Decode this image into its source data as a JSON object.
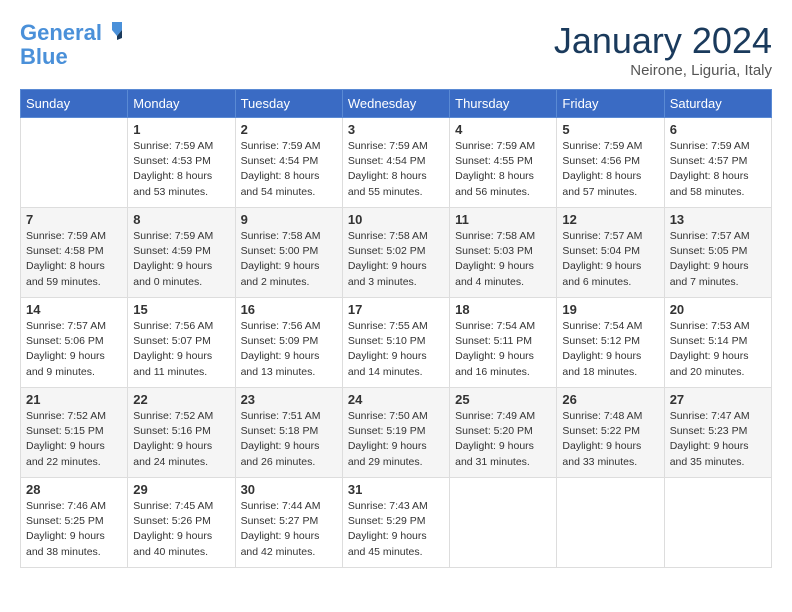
{
  "header": {
    "logo_line1": "General",
    "logo_line2": "Blue",
    "month": "January 2024",
    "location": "Neirone, Liguria, Italy"
  },
  "days_of_week": [
    "Sunday",
    "Monday",
    "Tuesday",
    "Wednesday",
    "Thursday",
    "Friday",
    "Saturday"
  ],
  "weeks": [
    [
      {
        "day": "",
        "info": ""
      },
      {
        "day": "1",
        "info": "Sunrise: 7:59 AM\nSunset: 4:53 PM\nDaylight: 8 hours\nand 53 minutes."
      },
      {
        "day": "2",
        "info": "Sunrise: 7:59 AM\nSunset: 4:54 PM\nDaylight: 8 hours\nand 54 minutes."
      },
      {
        "day": "3",
        "info": "Sunrise: 7:59 AM\nSunset: 4:54 PM\nDaylight: 8 hours\nand 55 minutes."
      },
      {
        "day": "4",
        "info": "Sunrise: 7:59 AM\nSunset: 4:55 PM\nDaylight: 8 hours\nand 56 minutes."
      },
      {
        "day": "5",
        "info": "Sunrise: 7:59 AM\nSunset: 4:56 PM\nDaylight: 8 hours\nand 57 minutes."
      },
      {
        "day": "6",
        "info": "Sunrise: 7:59 AM\nSunset: 4:57 PM\nDaylight: 8 hours\nand 58 minutes."
      }
    ],
    [
      {
        "day": "7",
        "info": "Sunrise: 7:59 AM\nSunset: 4:58 PM\nDaylight: 8 hours\nand 59 minutes."
      },
      {
        "day": "8",
        "info": "Sunrise: 7:59 AM\nSunset: 4:59 PM\nDaylight: 9 hours\nand 0 minutes."
      },
      {
        "day": "9",
        "info": "Sunrise: 7:58 AM\nSunset: 5:00 PM\nDaylight: 9 hours\nand 2 minutes."
      },
      {
        "day": "10",
        "info": "Sunrise: 7:58 AM\nSunset: 5:02 PM\nDaylight: 9 hours\nand 3 minutes."
      },
      {
        "day": "11",
        "info": "Sunrise: 7:58 AM\nSunset: 5:03 PM\nDaylight: 9 hours\nand 4 minutes."
      },
      {
        "day": "12",
        "info": "Sunrise: 7:57 AM\nSunset: 5:04 PM\nDaylight: 9 hours\nand 6 minutes."
      },
      {
        "day": "13",
        "info": "Sunrise: 7:57 AM\nSunset: 5:05 PM\nDaylight: 9 hours\nand 7 minutes."
      }
    ],
    [
      {
        "day": "14",
        "info": "Sunrise: 7:57 AM\nSunset: 5:06 PM\nDaylight: 9 hours\nand 9 minutes."
      },
      {
        "day": "15",
        "info": "Sunrise: 7:56 AM\nSunset: 5:07 PM\nDaylight: 9 hours\nand 11 minutes."
      },
      {
        "day": "16",
        "info": "Sunrise: 7:56 AM\nSunset: 5:09 PM\nDaylight: 9 hours\nand 13 minutes."
      },
      {
        "day": "17",
        "info": "Sunrise: 7:55 AM\nSunset: 5:10 PM\nDaylight: 9 hours\nand 14 minutes."
      },
      {
        "day": "18",
        "info": "Sunrise: 7:54 AM\nSunset: 5:11 PM\nDaylight: 9 hours\nand 16 minutes."
      },
      {
        "day": "19",
        "info": "Sunrise: 7:54 AM\nSunset: 5:12 PM\nDaylight: 9 hours\nand 18 minutes."
      },
      {
        "day": "20",
        "info": "Sunrise: 7:53 AM\nSunset: 5:14 PM\nDaylight: 9 hours\nand 20 minutes."
      }
    ],
    [
      {
        "day": "21",
        "info": "Sunrise: 7:52 AM\nSunset: 5:15 PM\nDaylight: 9 hours\nand 22 minutes."
      },
      {
        "day": "22",
        "info": "Sunrise: 7:52 AM\nSunset: 5:16 PM\nDaylight: 9 hours\nand 24 minutes."
      },
      {
        "day": "23",
        "info": "Sunrise: 7:51 AM\nSunset: 5:18 PM\nDaylight: 9 hours\nand 26 minutes."
      },
      {
        "day": "24",
        "info": "Sunrise: 7:50 AM\nSunset: 5:19 PM\nDaylight: 9 hours\nand 29 minutes."
      },
      {
        "day": "25",
        "info": "Sunrise: 7:49 AM\nSunset: 5:20 PM\nDaylight: 9 hours\nand 31 minutes."
      },
      {
        "day": "26",
        "info": "Sunrise: 7:48 AM\nSunset: 5:22 PM\nDaylight: 9 hours\nand 33 minutes."
      },
      {
        "day": "27",
        "info": "Sunrise: 7:47 AM\nSunset: 5:23 PM\nDaylight: 9 hours\nand 35 minutes."
      }
    ],
    [
      {
        "day": "28",
        "info": "Sunrise: 7:46 AM\nSunset: 5:25 PM\nDaylight: 9 hours\nand 38 minutes."
      },
      {
        "day": "29",
        "info": "Sunrise: 7:45 AM\nSunset: 5:26 PM\nDaylight: 9 hours\nand 40 minutes."
      },
      {
        "day": "30",
        "info": "Sunrise: 7:44 AM\nSunset: 5:27 PM\nDaylight: 9 hours\nand 42 minutes."
      },
      {
        "day": "31",
        "info": "Sunrise: 7:43 AM\nSunset: 5:29 PM\nDaylight: 9 hours\nand 45 minutes."
      },
      {
        "day": "",
        "info": ""
      },
      {
        "day": "",
        "info": ""
      },
      {
        "day": "",
        "info": ""
      }
    ]
  ]
}
